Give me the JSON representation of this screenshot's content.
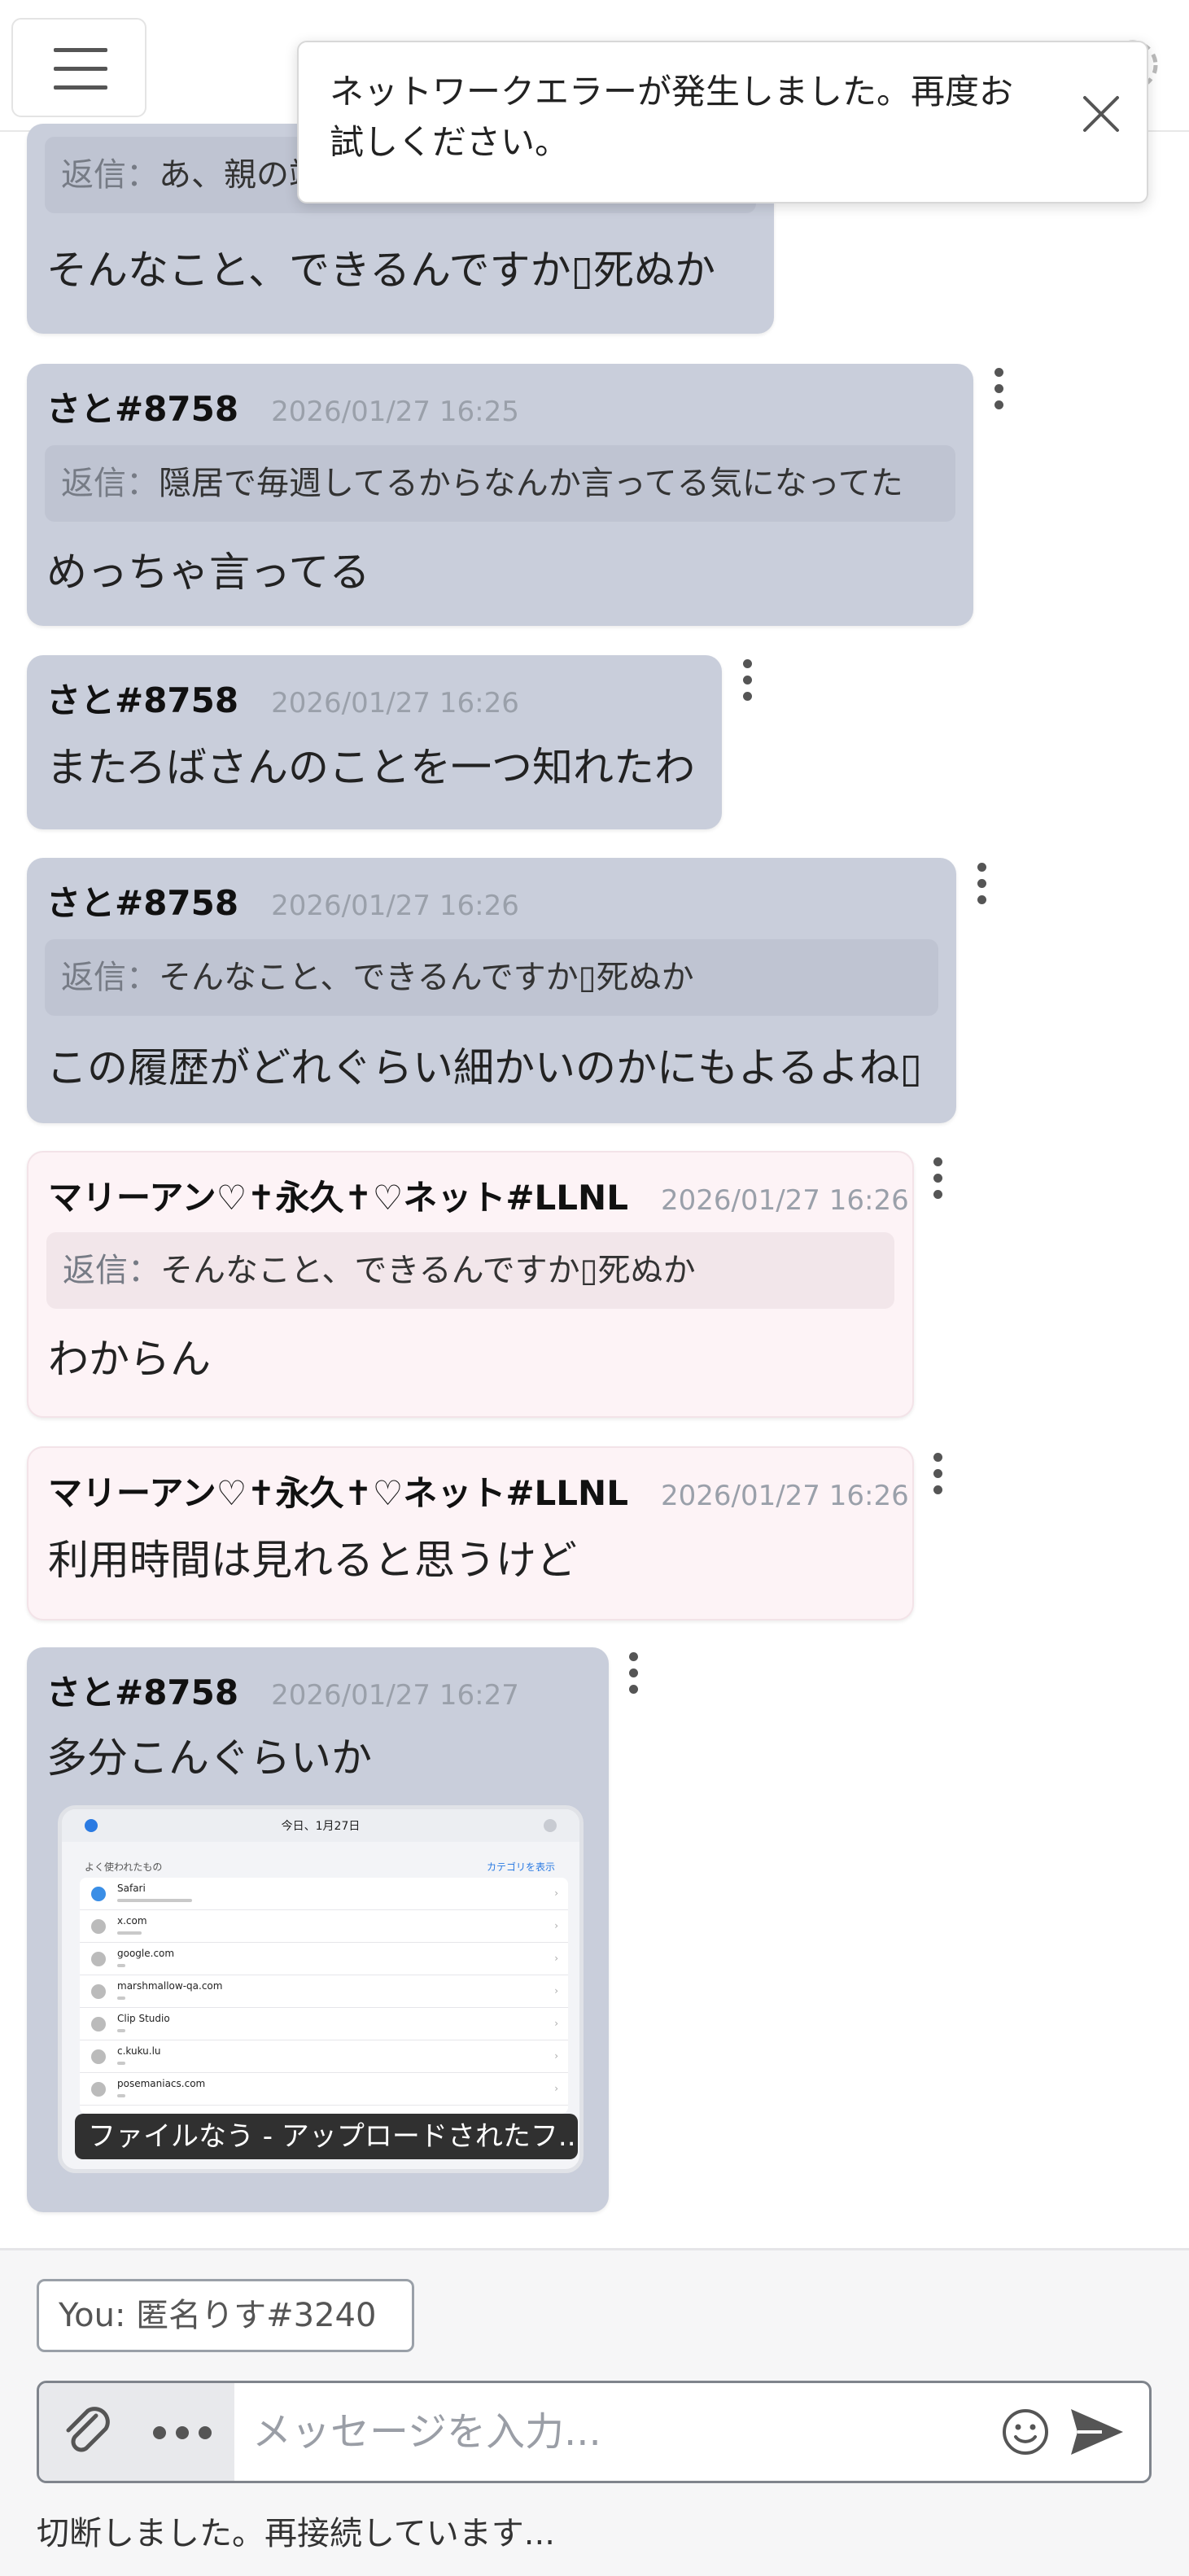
{
  "toast": {
    "message": "ネットワークエラーが発生しました。再度お試しください。"
  },
  "messages": [
    {
      "author": "",
      "time": "",
      "reply_label": "返信：",
      "reply": "あ、親の端末から履歴とか見れるのか",
      "text": "そんなこと、できるんですか▯死ぬか"
    },
    {
      "author": "さと#8758",
      "time": "2026/01/27 16:25",
      "reply_label": "返信：",
      "reply": "隠居で毎週してるからなんか言ってる気になってた",
      "text": "めっちゃ言ってる"
    },
    {
      "author": "さと#8758",
      "time": "2026/01/27 16:26",
      "reply_label": "",
      "reply": "",
      "text": "またろばさんのことを一つ知れたわ"
    },
    {
      "author": "さと#8758",
      "time": "2026/01/27 16:26",
      "reply_label": "返信：",
      "reply": "そんなこと、できるんですか▯死ぬか",
      "text": "この履歴がどれぐらい細かいのかにもよるよね▯"
    },
    {
      "author": "マリーアン♡✝永久✝♡ネット#LLNL",
      "time": "2026/01/27 16:26",
      "reply_label": "返信：",
      "reply": "そんなこと、できるんですか▯死ぬか",
      "text": "わからん"
    },
    {
      "author": "マリーアン♡✝永久✝♡ネット#LLNL",
      "time": "2026/01/27 16:26",
      "reply_label": "",
      "reply": "",
      "text": "利用時間は見れると思うけど"
    },
    {
      "author": "さと#8758",
      "time": "2026/01/27 16:27",
      "reply_label": "",
      "reply": "",
      "text": "多分こんぐらいか"
    }
  ],
  "attachment": {
    "caption": "ファイルなう - アップロードされたフ...",
    "screenshot": {
      "date": "今日、1月27日",
      "subtitle": "よく使われたもの",
      "category_link": "カテゴリを表示",
      "rows": [
        {
          "name": "Safari",
          "usage": 0.46
        },
        {
          "name": "x.com",
          "usage": 0.15
        },
        {
          "name": "google.com",
          "usage": 0.03
        },
        {
          "name": "marshmallow-qa.com",
          "usage": 0.03
        },
        {
          "name": "Clip Studio",
          "usage": 0.03
        },
        {
          "name": "c.kuku.lu",
          "usage": 0.03
        },
        {
          "name": "posemaniacs.com",
          "usage": 0.02
        }
      ]
    }
  },
  "composer": {
    "identity": "You: 匿名りす#3240",
    "placeholder": "メッセージを入力...",
    "status": "切断しました。再接続しています..."
  },
  "icons": {
    "menu": "hamburger-icon",
    "close": "close-icon",
    "more": "kebab-menu-icon",
    "attach": "paperclip-icon",
    "options": "ellipsis-icon",
    "emoji": "smiley-icon",
    "send": "send-icon",
    "settings": "gear-icon"
  },
  "colors": {
    "mine_bubble": "#c9cedb",
    "other_bubble": "#fdf3f6",
    "timestamp": "#9aa0aa"
  }
}
